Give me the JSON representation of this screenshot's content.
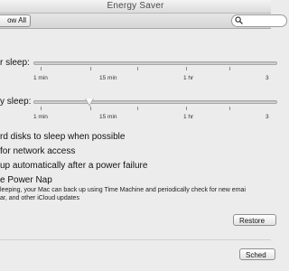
{
  "window": {
    "title": "Energy Saver"
  },
  "toolbar": {
    "show_all_label": "ow All",
    "search_placeholder": ""
  },
  "sliders": [
    {
      "label": "r sleep:",
      "ticks": [
        "1 min",
        "15 min",
        "1 hr",
        "3"
      ],
      "knob_visible": false
    },
    {
      "label": "y sleep:",
      "ticks": [
        "1 min",
        "15 min",
        "1 hr",
        "3"
      ],
      "knob_visible": true
    }
  ],
  "options": [
    "rd disks to sleep when possible",
    "for network access",
    "up automatically after a power failure",
    "e Power Nap"
  ],
  "power_nap_description": [
    "leeping, your Mac can back up using Time Machine and periodically check for new emai",
    "ar, and other iCloud updates"
  ],
  "buttons": {
    "restore_label": "Restore",
    "schedule_label": "Sched"
  }
}
